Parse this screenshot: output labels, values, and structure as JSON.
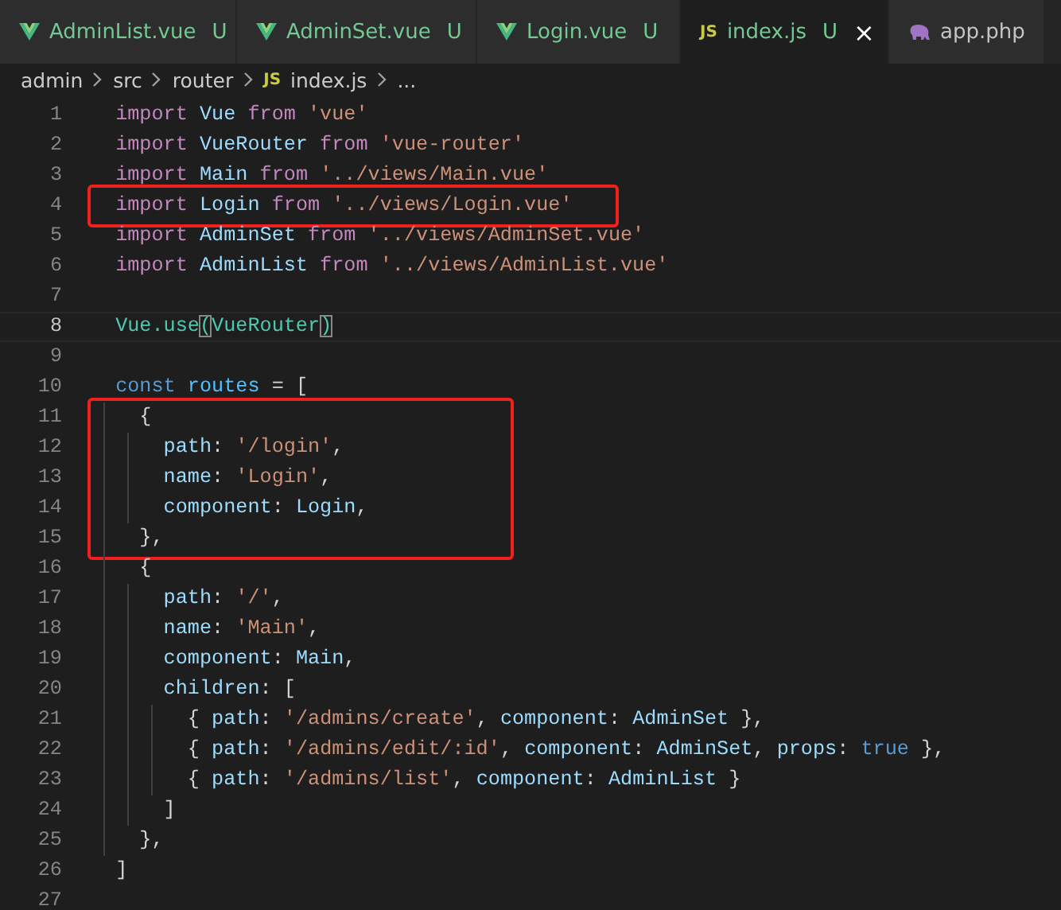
{
  "tabs": [
    {
      "kind": "vue",
      "label": "AdminList.vue",
      "status": "U",
      "selected": false
    },
    {
      "kind": "vue",
      "label": "AdminSet.vue",
      "status": "U",
      "selected": false
    },
    {
      "kind": "vue",
      "label": "Login.vue",
      "status": "U",
      "selected": false
    },
    {
      "kind": "js",
      "badge": "JS",
      "label": "index.js",
      "status": "U",
      "close": "×",
      "selected": true
    },
    {
      "kind": "php",
      "label": "app.php",
      "selected": false
    }
  ],
  "breadcrumb": [
    {
      "label": "admin"
    },
    {
      "label": "src"
    },
    {
      "label": "router"
    },
    {
      "badge": "JS",
      "label": "index.js"
    },
    {
      "label": "..."
    }
  ],
  "code_groups": [
    {
      "kind": "plain",
      "lines": [
        {
          "number": "1",
          "tokens": [
            {
              "kind": "keyword",
              "text": "import "
            },
            {
              "kind": "ident",
              "text": "Vue "
            },
            {
              "kind": "keyword",
              "text": "from "
            },
            {
              "kind": "string",
              "text": "'vue'"
            }
          ]
        },
        {
          "number": "2",
          "tokens": [
            {
              "kind": "keyword",
              "text": "import "
            },
            {
              "kind": "ident",
              "text": "VueRouter "
            },
            {
              "kind": "keyword",
              "text": "from "
            },
            {
              "kind": "string",
              "text": "'vue-router'"
            }
          ]
        },
        {
          "number": "3",
          "tokens": [
            {
              "kind": "keyword",
              "text": "import "
            },
            {
              "kind": "ident",
              "text": "Main "
            },
            {
              "kind": "keyword",
              "text": "from "
            },
            {
              "kind": "string",
              "text": "'../views/Main.vue'"
            }
          ]
        }
      ]
    },
    {
      "kind": "boxed",
      "lines": [
        {
          "number": "4",
          "tokens": [
            {
              "kind": "keyword",
              "text": "import "
            },
            {
              "kind": "ident",
              "text": "Login "
            },
            {
              "kind": "keyword",
              "text": "from "
            },
            {
              "kind": "string",
              "text": "'../views/Login.vue'"
            }
          ]
        }
      ]
    },
    {
      "kind": "plain",
      "lines": [
        {
          "number": "5",
          "tokens": [
            {
              "kind": "keyword",
              "text": "import "
            },
            {
              "kind": "ident",
              "text": "AdminSet "
            },
            {
              "kind": "keyword",
              "text": "from "
            },
            {
              "kind": "string",
              "text": "'../views/AdminSet.vue'"
            }
          ]
        },
        {
          "number": "6",
          "tokens": [
            {
              "kind": "keyword",
              "text": "import "
            },
            {
              "kind": "ident",
              "text": "AdminList "
            },
            {
              "kind": "keyword",
              "text": "from "
            },
            {
              "kind": "string",
              "text": "'../views/AdminList.vue'"
            }
          ]
        },
        {
          "number": "7"
        },
        {
          "number": "8",
          "current": true,
          "tokens": [
            {
              "kind": "class",
              "text": "Vue.use"
            },
            {
              "kind": "bracket",
              "text": "("
            },
            {
              "kind": "class",
              "text": "VueRouter"
            },
            {
              "kind": "bracket",
              "text": ")"
            }
          ]
        },
        {
          "number": "9"
        },
        {
          "number": "10",
          "tokens": [
            {
              "kind": "storage",
              "text": "const "
            },
            {
              "kind": "constant",
              "text": "routes"
            },
            {
              "kind": "plain",
              "text": " = ["
            }
          ]
        }
      ]
    },
    {
      "kind": "boxed",
      "lines": [
        {
          "number": "11",
          "tokens": [
            {
              "kind": "plain",
              "text": "  {"
            }
          ]
        },
        {
          "number": "12",
          "tokens": [
            {
              "kind": "ident",
              "text": "    path"
            },
            {
              "kind": "plain",
              "text": ": "
            },
            {
              "kind": "string",
              "text": "'/login'"
            },
            {
              "kind": "plain",
              "text": ","
            }
          ]
        },
        {
          "number": "13",
          "tokens": [
            {
              "kind": "ident",
              "text": "    name"
            },
            {
              "kind": "plain",
              "text": ": "
            },
            {
              "kind": "string",
              "text": "'Login'"
            },
            {
              "kind": "plain",
              "text": ","
            }
          ]
        },
        {
          "number": "14",
          "tokens": [
            {
              "kind": "ident",
              "text": "    component"
            },
            {
              "kind": "plain",
              "text": ": "
            },
            {
              "kind": "ident",
              "text": "Login"
            },
            {
              "kind": "plain",
              "text": ","
            }
          ]
        },
        {
          "number": "15",
          "tokens": [
            {
              "kind": "plain",
              "text": "  },"
            }
          ]
        }
      ]
    },
    {
      "kind": "plain",
      "lines": [
        {
          "number": "16",
          "tokens": [
            {
              "kind": "plain",
              "text": "  {"
            }
          ]
        },
        {
          "number": "17",
          "tokens": [
            {
              "kind": "ident",
              "text": "    path"
            },
            {
              "kind": "plain",
              "text": ": "
            },
            {
              "kind": "string",
              "text": "'/'"
            },
            {
              "kind": "plain",
              "text": ","
            }
          ]
        },
        {
          "number": "18",
          "tokens": [
            {
              "kind": "ident",
              "text": "    name"
            },
            {
              "kind": "plain",
              "text": ": "
            },
            {
              "kind": "string",
              "text": "'Main'"
            },
            {
              "kind": "plain",
              "text": ","
            }
          ]
        },
        {
          "number": "19",
          "tokens": [
            {
              "kind": "ident",
              "text": "    component"
            },
            {
              "kind": "plain",
              "text": ": "
            },
            {
              "kind": "ident",
              "text": "Main"
            },
            {
              "kind": "plain",
              "text": ","
            }
          ]
        },
        {
          "number": "20",
          "tokens": [
            {
              "kind": "ident",
              "text": "    children"
            },
            {
              "kind": "plain",
              "text": ": ["
            }
          ]
        },
        {
          "number": "21",
          "tokens": [
            {
              "kind": "plain",
              "text": "      { "
            },
            {
              "kind": "ident",
              "text": "path"
            },
            {
              "kind": "plain",
              "text": ": "
            },
            {
              "kind": "string",
              "text": "'/admins/create'"
            },
            {
              "kind": "plain",
              "text": ", "
            },
            {
              "kind": "ident",
              "text": "component"
            },
            {
              "kind": "plain",
              "text": ": "
            },
            {
              "kind": "ident",
              "text": "AdminSet"
            },
            {
              "kind": "plain",
              "text": " },"
            }
          ]
        },
        {
          "number": "22",
          "tokens": [
            {
              "kind": "plain",
              "text": "      { "
            },
            {
              "kind": "ident",
              "text": "path"
            },
            {
              "kind": "plain",
              "text": ": "
            },
            {
              "kind": "string",
              "text": "'/admins/edit/:id'"
            },
            {
              "kind": "plain",
              "text": ", "
            },
            {
              "kind": "ident",
              "text": "component"
            },
            {
              "kind": "plain",
              "text": ": "
            },
            {
              "kind": "ident",
              "text": "AdminSet"
            },
            {
              "kind": "plain",
              "text": ", "
            },
            {
              "kind": "ident",
              "text": "props"
            },
            {
              "kind": "plain",
              "text": ": "
            },
            {
              "kind": "storage",
              "text": "true"
            },
            {
              "kind": "plain",
              "text": " },"
            }
          ]
        },
        {
          "number": "23",
          "tokens": [
            {
              "kind": "plain",
              "text": "      { "
            },
            {
              "kind": "ident",
              "text": "path"
            },
            {
              "kind": "plain",
              "text": ": "
            },
            {
              "kind": "string",
              "text": "'/admins/list'"
            },
            {
              "kind": "plain",
              "text": ", "
            },
            {
              "kind": "ident",
              "text": "component"
            },
            {
              "kind": "plain",
              "text": ": "
            },
            {
              "kind": "ident",
              "text": "AdminList"
            },
            {
              "kind": "plain",
              "text": " }"
            }
          ]
        },
        {
          "number": "24",
          "tokens": [
            {
              "kind": "plain",
              "text": "    ]"
            }
          ]
        },
        {
          "number": "25",
          "tokens": [
            {
              "kind": "plain",
              "text": "  },"
            }
          ]
        },
        {
          "number": "26",
          "tokens": [
            {
              "kind": "plain",
              "text": "]"
            }
          ]
        },
        {
          "number": "27"
        }
      ]
    }
  ]
}
